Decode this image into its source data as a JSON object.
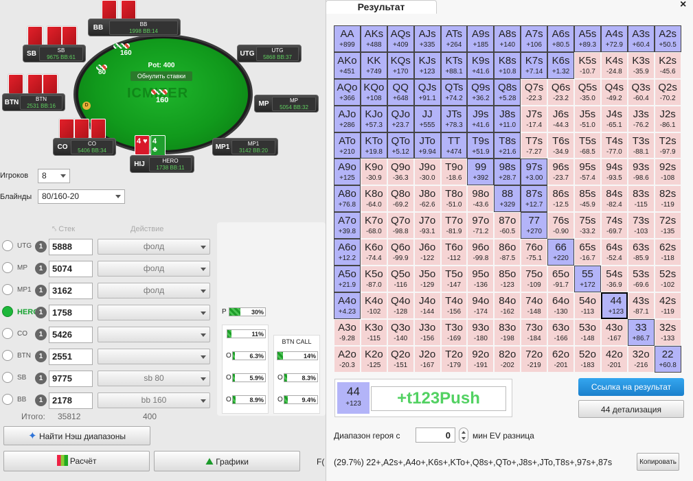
{
  "table": {
    "pot_label": "Pot: 400",
    "reset_label": "Обнулить ставки",
    "logo_text": "ICMIZER",
    "center_chips": "160",
    "dealer_label": "D",
    "seats": [
      {
        "key": "bb",
        "label": "BB",
        "name": "BB",
        "stack": "1998 BB:14"
      },
      {
        "key": "sb",
        "label": "SB",
        "name": "SB",
        "stack": "9675 BB:61"
      },
      {
        "key": "utg",
        "label": "UTG",
        "name": "UTG",
        "stack": "5868 BB:37"
      },
      {
        "key": "btn",
        "label": "BTN",
        "name": "BTN",
        "stack": "2531 BB:16"
      },
      {
        "key": "mp",
        "label": "MP",
        "name": "MP",
        "stack": "5054 BB:32"
      },
      {
        "key": "co",
        "label": "CO",
        "name": "CO",
        "stack": "5406 BB:34"
      },
      {
        "key": "mp1",
        "label": "MP1",
        "name": "MP1",
        "stack": "3142 BB:20"
      },
      {
        "key": "hero",
        "label": "HIJ",
        "name": "HERO",
        "stack": "1738 BB:11"
      }
    ],
    "bb_bet": "160",
    "sb_bet": "80",
    "hero_cards": [
      "4 ♥",
      "4 ♣"
    ],
    "colors": {
      "felt": "#13a21f",
      "card_red": "#d8182a",
      "card_green": "#1f9f2e"
    }
  },
  "settings": {
    "players_label": "Игроков",
    "players_value": "8",
    "blinds_label": "Блайнды",
    "blinds_value": "80/160-20"
  },
  "players_table": {
    "stack_header": "Стек",
    "action_header": "Действие",
    "rows": [
      {
        "pos": "UTG",
        "stack": "5888",
        "action": "фолд"
      },
      {
        "pos": "MP",
        "stack": "5074",
        "action": "фолд"
      },
      {
        "pos": "MP1",
        "stack": "3162",
        "action": "фолд"
      },
      {
        "pos": "HERO",
        "stack": "1758",
        "action": ""
      },
      {
        "pos": "CO",
        "stack": "5426",
        "action": ""
      },
      {
        "pos": "BTN",
        "stack": "2551",
        "action": ""
      },
      {
        "pos": "SB",
        "stack": "9775",
        "action": "sb 80"
      },
      {
        "pos": "BB",
        "stack": "2178",
        "action": "bb 160"
      }
    ],
    "position_count": "1",
    "total_label": "Итого:",
    "total_stack": "35812",
    "total_bet": "400"
  },
  "ranges": {
    "push_label": "P",
    "push_pct": "30%",
    "push_value": 0.3,
    "call_co_pct": "11%",
    "call_co_value": 0.11,
    "btn_call_header": "BTN CALL",
    "btn_call_label": "O",
    "rows": [
      {
        "a_label": "O",
        "a_pct": "6.3%",
        "a": 0.063,
        "b_pct": "14%",
        "b": 0.14
      },
      {
        "a_label": "O",
        "a_pct": "5.9%",
        "a": 0.059,
        "b_pct": "8.3%",
        "b": 0.083
      },
      {
        "a_label": "O",
        "a_pct": "8.9%",
        "a": 0.089,
        "b_pct": "9.4%",
        "b": 0.094
      }
    ]
  },
  "buttons": {
    "nash": "Найти Нэш диапазоны",
    "calc": "Расчёт",
    "graphs": "Графики",
    "partial": "F("
  },
  "result": {
    "tab_title": "Результат",
    "close": "×",
    "selected_hand": "44",
    "selected_ev": "+123",
    "selected_result": "+t123Push",
    "link_button": "Ссылка на результат",
    "detail_button": "44 детализация",
    "hero_range_label": "Диапазон героя с",
    "min_ev_value": "0",
    "min_ev_label": "мин EV разница",
    "range_text": "(29.7%) 22+,A2s+,A4o+,K6s+,KTo+,Q8s+,QTo+,J8s+,JTo,T8s+,97s+,87s",
    "copy_button": "Копировать",
    "colors": {
      "push": "#b3b4f8",
      "fold": "#f5d4d4",
      "positive_text": "#52d162"
    },
    "matrix": [
      [
        [
          "AA",
          "+899"
        ],
        [
          "AKs",
          "+488"
        ],
        [
          "AQs",
          "+409"
        ],
        [
          "AJs",
          "+335"
        ],
        [
          "ATs",
          "+264"
        ],
        [
          "A9s",
          "+185"
        ],
        [
          "A8s",
          "+140"
        ],
        [
          "A7s",
          "+106"
        ],
        [
          "A6s",
          "+80.5"
        ],
        [
          "A5s",
          "+89.3"
        ],
        [
          "A4s",
          "+72.9"
        ],
        [
          "A3s",
          "+60.4"
        ],
        [
          "A2s",
          "+50.5"
        ]
      ],
      [
        [
          "AKo",
          "+451"
        ],
        [
          "KK",
          "+749"
        ],
        [
          "KQs",
          "+170"
        ],
        [
          "KJs",
          "+123"
        ],
        [
          "KTs",
          "+88.1"
        ],
        [
          "K9s",
          "+41.6"
        ],
        [
          "K8s",
          "+10.8"
        ],
        [
          "K7s",
          "+7.14"
        ],
        [
          "K6s",
          "+1.32"
        ],
        [
          "K5s",
          "-10.7"
        ],
        [
          "K4s",
          "-24.8"
        ],
        [
          "K3s",
          "-35.9"
        ],
        [
          "K2s",
          "-45.6"
        ]
      ],
      [
        [
          "AQo",
          "+366"
        ],
        [
          "KQo",
          "+108"
        ],
        [
          "QQ",
          "+648"
        ],
        [
          "QJs",
          "+91.1"
        ],
        [
          "QTs",
          "+74.2"
        ],
        [
          "Q9s",
          "+36.2"
        ],
        [
          "Q8s",
          "+5.28"
        ],
        [
          "Q7s",
          "-22.3"
        ],
        [
          "Q6s",
          "-23.2"
        ],
        [
          "Q5s",
          "-35.0"
        ],
        [
          "Q4s",
          "-49.2"
        ],
        [
          "Q3s",
          "-60.4"
        ],
        [
          "Q2s",
          "-70.2"
        ]
      ],
      [
        [
          "AJo",
          "+286"
        ],
        [
          "KJo",
          "+57.3"
        ],
        [
          "QJo",
          "+23.7"
        ],
        [
          "JJ",
          "+555"
        ],
        [
          "JTs",
          "+78.3"
        ],
        [
          "J9s",
          "+41.6"
        ],
        [
          "J8s",
          "+11.0"
        ],
        [
          "J7s",
          "-17.4"
        ],
        [
          "J6s",
          "-44.3"
        ],
        [
          "J5s",
          "-51.0"
        ],
        [
          "J4s",
          "-65.1"
        ],
        [
          "J3s",
          "-76.2"
        ],
        [
          "J2s",
          "-86.1"
        ]
      ],
      [
        [
          "ATo",
          "+210"
        ],
        [
          "KTo",
          "+19.8"
        ],
        [
          "QTo",
          "+5.12"
        ],
        [
          "JTo",
          "+9.94"
        ],
        [
          "TT",
          "+474"
        ],
        [
          "T9s",
          "+51.9"
        ],
        [
          "T8s",
          "+21.6"
        ],
        [
          "T7s",
          "-7.27"
        ],
        [
          "T6s",
          "-34.9"
        ],
        [
          "T5s",
          "-68.5"
        ],
        [
          "T4s",
          "-77.0"
        ],
        [
          "T3s",
          "-88.1"
        ],
        [
          "T2s",
          "-97.9"
        ]
      ],
      [
        [
          "A9o",
          "+125"
        ],
        [
          "K9o",
          "-30.9"
        ],
        [
          "Q9o",
          "-36.3"
        ],
        [
          "J9o",
          "-30.0"
        ],
        [
          "T9o",
          "-18.6"
        ],
        [
          "99",
          "+392"
        ],
        [
          "98s",
          "+28.7"
        ],
        [
          "97s",
          "+3.00"
        ],
        [
          "96s",
          "-23.7"
        ],
        [
          "95s",
          "-57.4"
        ],
        [
          "94s",
          "-93.5"
        ],
        [
          "93s",
          "-98.6"
        ],
        [
          "92s",
          "-108"
        ]
      ],
      [
        [
          "A8o",
          "+76.8"
        ],
        [
          "K8o",
          "-64.0"
        ],
        [
          "Q8o",
          "-69.2"
        ],
        [
          "J8o",
          "-62.6"
        ],
        [
          "T8o",
          "-51.0"
        ],
        [
          "98o",
          "-43.6"
        ],
        [
          "88",
          "+329"
        ],
        [
          "87s",
          "+12.7"
        ],
        [
          "86s",
          "-12.5"
        ],
        [
          "85s",
          "-45.9"
        ],
        [
          "84s",
          "-82.4"
        ],
        [
          "83s",
          "-115"
        ],
        [
          "82s",
          "-119"
        ]
      ],
      [
        [
          "A7o",
          "+39.8"
        ],
        [
          "K7o",
          "-68.0"
        ],
        [
          "Q7o",
          "-98.8"
        ],
        [
          "J7o",
          "-93.1"
        ],
        [
          "T7o",
          "-81.9"
        ],
        [
          "97o",
          "-71.2"
        ],
        [
          "87o",
          "-60.5"
        ],
        [
          "77",
          "+270"
        ],
        [
          "76s",
          "-0.90"
        ],
        [
          "75s",
          "-33.2"
        ],
        [
          "74s",
          "-69.7"
        ],
        [
          "73s",
          "-103"
        ],
        [
          "72s",
          "-135"
        ]
      ],
      [
        [
          "A6o",
          "+12.2"
        ],
        [
          "K6o",
          "-74.4"
        ],
        [
          "Q6o",
          "-99.9"
        ],
        [
          "J6o",
          "-122"
        ],
        [
          "T6o",
          "-112"
        ],
        [
          "96o",
          "-99.8"
        ],
        [
          "86o",
          "-87.5"
        ],
        [
          "76o",
          "-75.1"
        ],
        [
          "66",
          "+220"
        ],
        [
          "65s",
          "-16.7"
        ],
        [
          "64s",
          "-52.4"
        ],
        [
          "63s",
          "-85.9"
        ],
        [
          "62s",
          "-118"
        ]
      ],
      [
        [
          "A5o",
          "+21.9"
        ],
        [
          "K5o",
          "-87.0"
        ],
        [
          "Q5o",
          "-116"
        ],
        [
          "J5o",
          "-129"
        ],
        [
          "T5o",
          "-147"
        ],
        [
          "95o",
          "-136"
        ],
        [
          "85o",
          "-123"
        ],
        [
          "75o",
          "-109"
        ],
        [
          "65o",
          "-91.7"
        ],
        [
          "55",
          "+172"
        ],
        [
          "54s",
          "-36.9"
        ],
        [
          "53s",
          "-69.6"
        ],
        [
          "52s",
          "-102"
        ]
      ],
      [
        [
          "A4o",
          "+4.23"
        ],
        [
          "K4o",
          "-102"
        ],
        [
          "Q4o",
          "-128"
        ],
        [
          "J4o",
          "-144"
        ],
        [
          "T4o",
          "-156"
        ],
        [
          "94o",
          "-174"
        ],
        [
          "84o",
          "-162"
        ],
        [
          "74o",
          "-148"
        ],
        [
          "64o",
          "-130"
        ],
        [
          "54o",
          "-113"
        ],
        [
          "44",
          "+123"
        ],
        [
          "43s",
          "-87.1"
        ],
        [
          "42s",
          "-119"
        ]
      ],
      [
        [
          "A3o",
          "-9.28"
        ],
        [
          "K3o",
          "-115"
        ],
        [
          "Q3o",
          "-140"
        ],
        [
          "J3o",
          "-156"
        ],
        [
          "T3o",
          "-169"
        ],
        [
          "93o",
          "-180"
        ],
        [
          "83o",
          "-198"
        ],
        [
          "73o",
          "-184"
        ],
        [
          "63o",
          "-166"
        ],
        [
          "53o",
          "-148"
        ],
        [
          "43o",
          "-167"
        ],
        [
          "33",
          "+86.7"
        ],
        [
          "32s",
          "-133"
        ]
      ],
      [
        [
          "A2o",
          "-20.3"
        ],
        [
          "K2o",
          "-125"
        ],
        [
          "Q2o",
          "-151"
        ],
        [
          "J2o",
          "-167"
        ],
        [
          "T2o",
          "-179"
        ],
        [
          "92o",
          "-191"
        ],
        [
          "82o",
          "-202"
        ],
        [
          "72o",
          "-219"
        ],
        [
          "62o",
          "-201"
        ],
        [
          "52o",
          "-183"
        ],
        [
          "42o",
          "-201"
        ],
        [
          "32o",
          "-216"
        ],
        [
          "22",
          "+60.8"
        ]
      ]
    ],
    "push_flags": [
      [
        1,
        1,
        1,
        1,
        1,
        1,
        1,
        1,
        1,
        1,
        1,
        1,
        1
      ],
      [
        1,
        1,
        1,
        1,
        1,
        1,
        1,
        1,
        1,
        0,
        0,
        0,
        0
      ],
      [
        1,
        1,
        1,
        1,
        1,
        1,
        1,
        0,
        0,
        0,
        0,
        0,
        0
      ],
      [
        1,
        1,
        1,
        1,
        1,
        1,
        1,
        0,
        0,
        0,
        0,
        0,
        0
      ],
      [
        1,
        1,
        1,
        1,
        1,
        1,
        1,
        0,
        0,
        0,
        0,
        0,
        0
      ],
      [
        1,
        0,
        0,
        0,
        0,
        1,
        1,
        1,
        0,
        0,
        0,
        0,
        0
      ],
      [
        1,
        0,
        0,
        0,
        0,
        0,
        1,
        1,
        0,
        0,
        0,
        0,
        0
      ],
      [
        1,
        0,
        0,
        0,
        0,
        0,
        0,
        1,
        0,
        0,
        0,
        0,
        0
      ],
      [
        1,
        0,
        0,
        0,
        0,
        0,
        0,
        0,
        1,
        0,
        0,
        0,
        0
      ],
      [
        1,
        0,
        0,
        0,
        0,
        0,
        0,
        0,
        0,
        1,
        0,
        0,
        0
      ],
      [
        1,
        0,
        0,
        0,
        0,
        0,
        0,
        0,
        0,
        0,
        1,
        0,
        0
      ],
      [
        0,
        0,
        0,
        0,
        0,
        0,
        0,
        0,
        0,
        0,
        0,
        1,
        0
      ],
      [
        0,
        0,
        0,
        0,
        0,
        0,
        0,
        0,
        0,
        0,
        0,
        0,
        1
      ]
    ],
    "selected_cell": [
      10,
      10
    ]
  }
}
